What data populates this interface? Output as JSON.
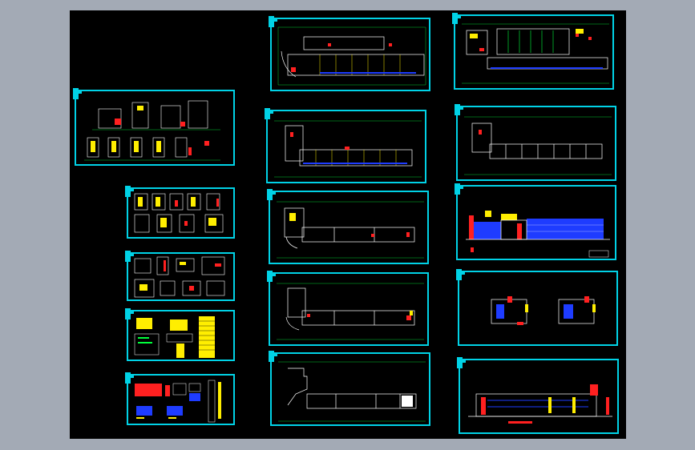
{
  "window": {
    "title": ""
  },
  "colors": {
    "background": "#a3aab5",
    "canvas": "#000000",
    "frame": "#00d2e6",
    "wall": "#ffffff",
    "grid": "#00ff3c",
    "accent_red": "#ff2020",
    "accent_yellow": "#ffee00",
    "accent_blue": "#1e3cff",
    "accent_magenta": "#ff30ff"
  },
  "sheets": [
    {
      "id": "s1",
      "kind": "elevation-details"
    },
    {
      "id": "s2",
      "kind": "stair-details"
    },
    {
      "id": "s3",
      "kind": "node-details"
    },
    {
      "id": "s4",
      "kind": "schedule-notes"
    },
    {
      "id": "s5",
      "kind": "window-details"
    },
    {
      "id": "p1",
      "kind": "plan-floor-1"
    },
    {
      "id": "p2",
      "kind": "plan-floor-2"
    },
    {
      "id": "p3",
      "kind": "plan-floor-3"
    },
    {
      "id": "p4",
      "kind": "plan-floor-4"
    },
    {
      "id": "p5",
      "kind": "roof-plan"
    },
    {
      "id": "r1",
      "kind": "site-plan"
    },
    {
      "id": "r2",
      "kind": "plan-floor-2-right"
    },
    {
      "id": "r3",
      "kind": "front-elevation"
    },
    {
      "id": "r4",
      "kind": "side-elevations"
    },
    {
      "id": "r5",
      "kind": "rear-elevation"
    }
  ]
}
